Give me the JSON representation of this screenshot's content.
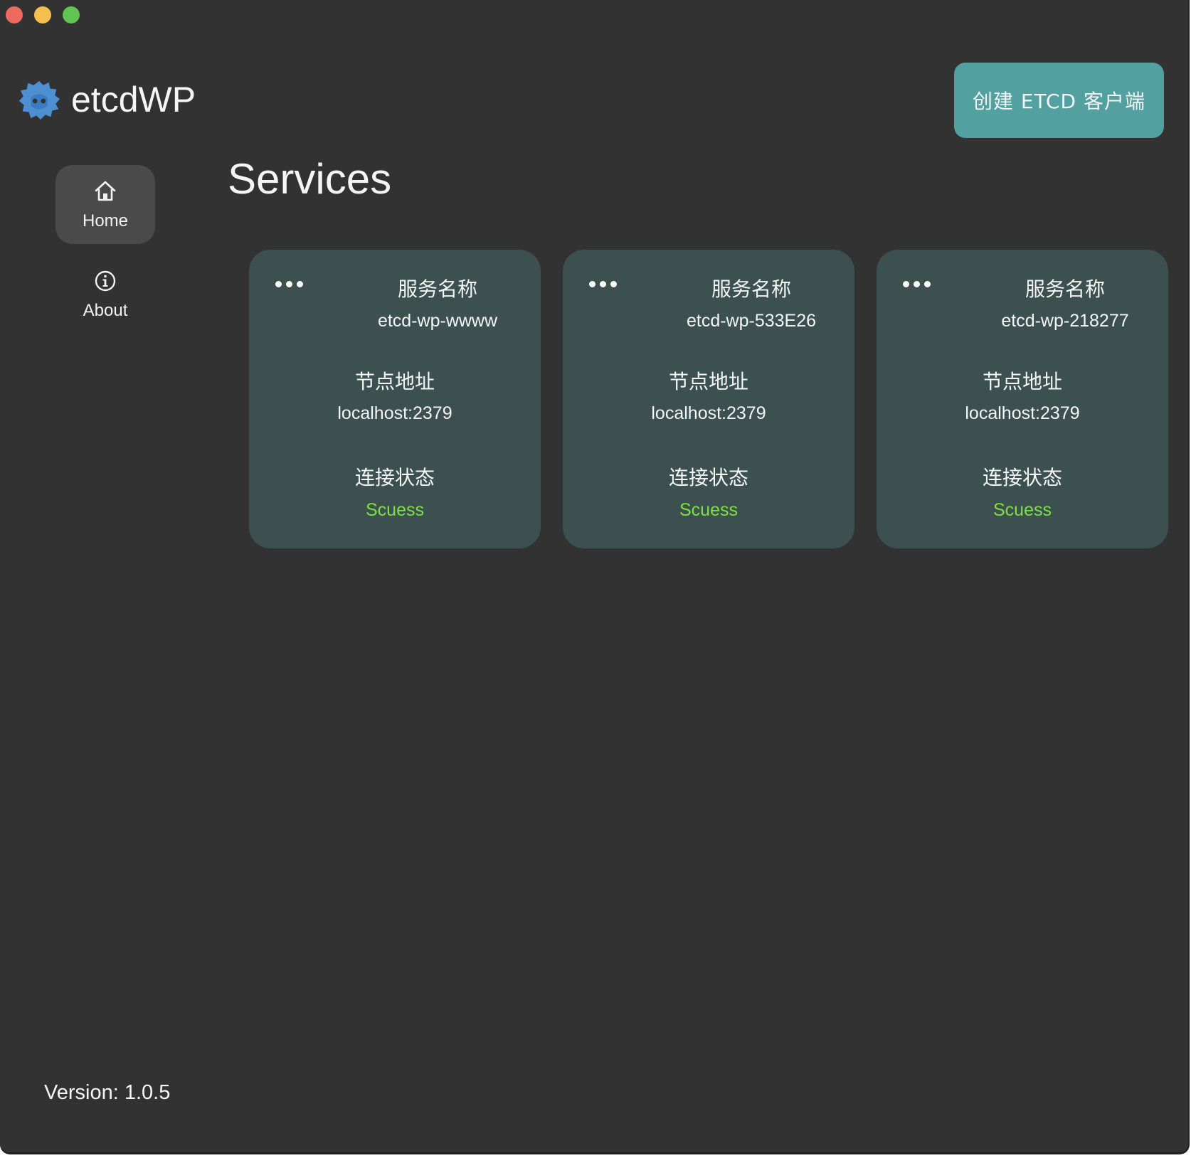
{
  "window": {
    "buttons": [
      "close",
      "minimize",
      "maximize"
    ]
  },
  "app": {
    "title": "etcdWP",
    "logo_icon": "etcd-gear-logo-icon",
    "create_button_label": "创建 ETCD 客户端"
  },
  "nav": {
    "items": [
      {
        "label": "Home",
        "icon": "home-icon",
        "active": true
      },
      {
        "label": "About",
        "icon": "info-icon",
        "active": false
      }
    ]
  },
  "main": {
    "title": "Services",
    "cards": [
      {
        "more_icon": "more-dots-icon",
        "name_label": "服务名称",
        "name_value": "etcd-wp-wwww",
        "addr_label": "节点地址",
        "addr_value": "localhost:2379",
        "status_label": "连接状态",
        "status_value": "Scuess"
      },
      {
        "more_icon": "more-dots-icon",
        "name_label": "服务名称",
        "name_value": "etcd-wp-533E26",
        "addr_label": "节点地址",
        "addr_value": "localhost:2379",
        "status_label": "连接状态",
        "status_value": "Scuess"
      },
      {
        "more_icon": "more-dots-icon",
        "name_label": "服务名称",
        "name_value": "etcd-wp-218277",
        "addr_label": "节点地址",
        "addr_value": "localhost:2379",
        "status_label": "连接状态",
        "status_value": "Scuess"
      }
    ]
  },
  "footer": {
    "version": "Version: 1.0.5"
  },
  "colors": {
    "background": "#323232",
    "card": "#3c5050",
    "accent_button": "#52a09f",
    "status_success": "#7ee042",
    "nav_active": "#4a4a4a",
    "logo": "#4d8fd1"
  }
}
